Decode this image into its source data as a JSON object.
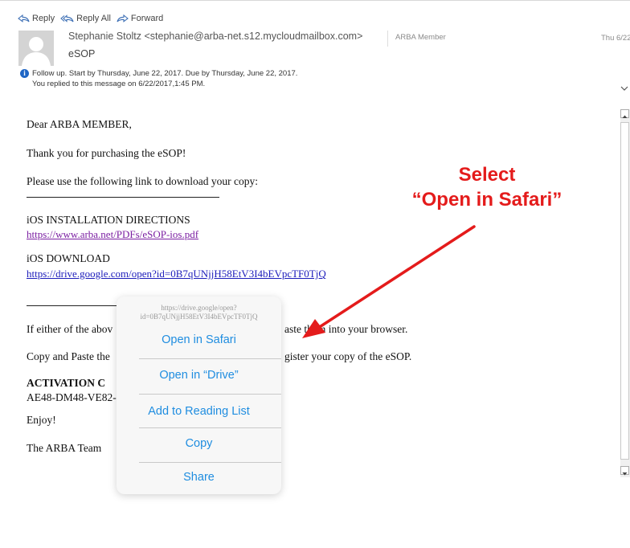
{
  "toolbar": {
    "reply": "Reply",
    "reply_all": "Reply All",
    "forward": "Forward"
  },
  "header": {
    "sender": "Stephanie Stoltz <stephanie@arba-net.s12.mycloudmailbox.com>",
    "tag": "ARBA Member",
    "date": "Thu 6/22",
    "subject": "eSOP",
    "followup": "Follow up.  Start by Thursday, June 22, 2017.  Due by Thursday, June 22, 2017.",
    "replied": "You replied to this message on 6/22/2017,1:45 PM."
  },
  "message": {
    "greeting": "Dear ARBA MEMBER,",
    "thanks": "Thank you for purchasing the eSOP!",
    "instruction": "Please use the following link to download your copy:",
    "ios_install_heading": "iOS INSTALLATION DIRECTIONS",
    "ios_install_link": "https://www.arba.net/PDFs/eSOP-ios.pdf",
    "ios_download_heading": "iOS DOWNLOAD",
    "ios_download_link": "https://drive.google.com/open?id=0B7qUNjjH58EtV3I4bEVpcTF0TjQ",
    "either_start": "If either of the abov",
    "either_end": "aste them into your browser.",
    "copy_start": "Copy and Paste the",
    "copy_end": "gister your copy of the eSOP.",
    "activation_start": "ACTIVATION C",
    "code_start": "AE48-DM48-VE82-",
    "enjoy": "Enjoy!",
    "signoff": "The ARBA Team"
  },
  "annotation": {
    "line1": "Select",
    "line2": "“Open in Safari”",
    "color": "#e41b1b"
  },
  "popover": {
    "url_line1": "https://drive.google/open?",
    "url_line2": "id=0B7qUNjjH58EtV3I4bEVpcTF0TjQ",
    "items": [
      "Open in Safari",
      "Open in “Drive”",
      "Add to Reading List",
      "Copy",
      "Share"
    ],
    "accent": "#1f8de0"
  }
}
